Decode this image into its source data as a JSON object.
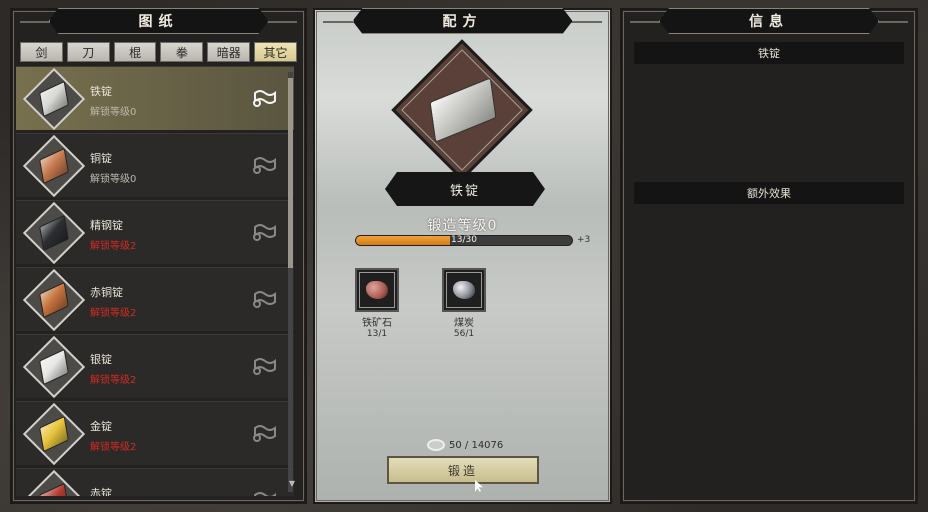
{
  "panels": {
    "blueprints_title": "图纸",
    "recipe_title": "配方",
    "info_title": "信息"
  },
  "tabs": [
    {
      "label": "剑"
    },
    {
      "label": "刀"
    },
    {
      "label": "棍"
    },
    {
      "label": "拳"
    },
    {
      "label": "暗器"
    },
    {
      "label": "其它",
      "active": true
    }
  ],
  "items": [
    {
      "name": "铁锭",
      "sub": "解锁等级0",
      "locked": false,
      "color": "#d8d8d4",
      "selected": true
    },
    {
      "name": "铜锭",
      "sub": "解锁等级0",
      "locked": false,
      "color": "#c77a4e"
    },
    {
      "name": "精钢锭",
      "sub": "解锁等级2",
      "locked": true,
      "color": "#2d2f33"
    },
    {
      "name": "赤铜锭",
      "sub": "解锁等级2",
      "locked": true,
      "color": "#c6733d"
    },
    {
      "name": "银锭",
      "sub": "解锁等级2",
      "locked": true,
      "color": "#e7e7e5"
    },
    {
      "name": "金锭",
      "sub": "解锁等级2",
      "locked": true,
      "color": "#e7c43b"
    },
    {
      "name": "赤锭",
      "sub": "",
      "locked": true,
      "color": "#b33b33"
    }
  ],
  "recipe": {
    "item_name": "铁锭",
    "forge_level": "锻造等级0",
    "progress_text": "13/30",
    "progress_fraction": 0.433,
    "bonus": "+3",
    "materials": [
      {
        "name": "铁矿石",
        "count": "13/1",
        "color": "#a85a52"
      },
      {
        "name": "煤炭",
        "count": "56/1",
        "color": "#8a8e96"
      }
    ],
    "currency": "50 / 14076",
    "forge_button": "锻造"
  },
  "info": {
    "item_name": "铁锭",
    "extra_effect": "额外效果"
  }
}
